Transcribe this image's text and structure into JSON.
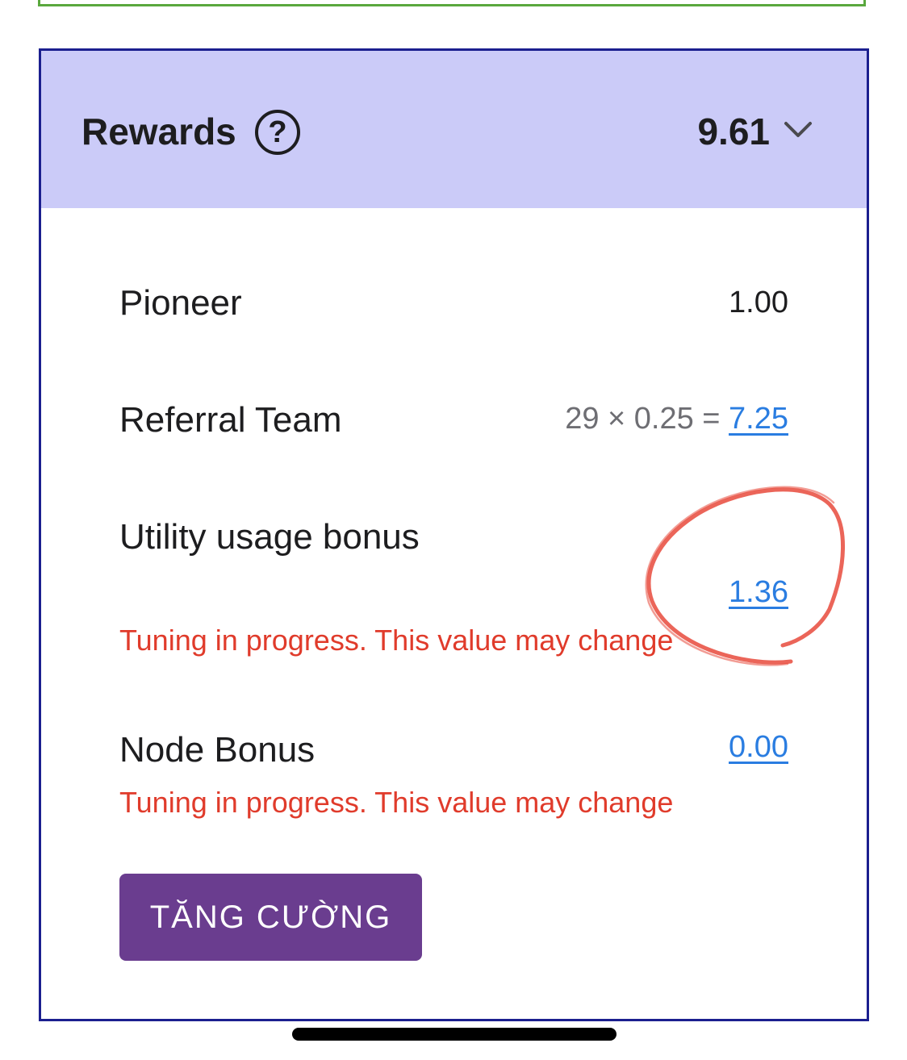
{
  "rewards": {
    "title": "Rewards",
    "help_icon": "?",
    "total": "9.61",
    "expand_icon": "chevron-down-icon"
  },
  "rows": {
    "pioneer": {
      "label": "Pioneer",
      "value": "1.00"
    },
    "referral_team": {
      "label": "Referral Team",
      "formula": "29 × 0.25 = ",
      "value": "7.25"
    },
    "utility_usage_bonus": {
      "label": "Utility usage bonus",
      "value": "1.36",
      "warning": "Tuning in progress. This value may change"
    },
    "node_bonus": {
      "label": "Node Bonus",
      "value": "0.00",
      "warning": "Tuning in progress. This value may change"
    }
  },
  "boost_button": {
    "label": "TĂNG CƯỜNG"
  },
  "colors": {
    "header_bg": "#cbcbf8",
    "card_border": "#1b1f8f",
    "link": "#2a7de1",
    "warning": "#e03b2b",
    "button_bg": "#6a3d8f",
    "annotation": "#e84a3c",
    "top_card_border": "#5aa83e"
  }
}
